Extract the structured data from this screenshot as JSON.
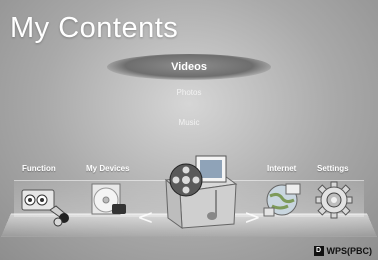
{
  "header": {
    "title": "My Contents"
  },
  "categories": {
    "items": [
      {
        "label": "Videos",
        "selected": true
      },
      {
        "label": "Photos",
        "selected": false
      },
      {
        "label": "Music",
        "selected": false
      }
    ]
  },
  "apps": {
    "function": {
      "label": "Function",
      "icon": "function-connectors-icon"
    },
    "my_devices": {
      "label": "My Devices",
      "icon": "disc-device-icon"
    },
    "center": {
      "icon": "film-reel-box-icon"
    },
    "internet": {
      "label": "Internet",
      "icon": "globe-internet-icon"
    },
    "settings": {
      "label": "Settings",
      "icon": "gear-icon"
    }
  },
  "navigation": {
    "left_arrow": "<",
    "right_arrow": ">"
  },
  "footer": {
    "badge": "D",
    "wps_label": "WPS(PBC)"
  }
}
